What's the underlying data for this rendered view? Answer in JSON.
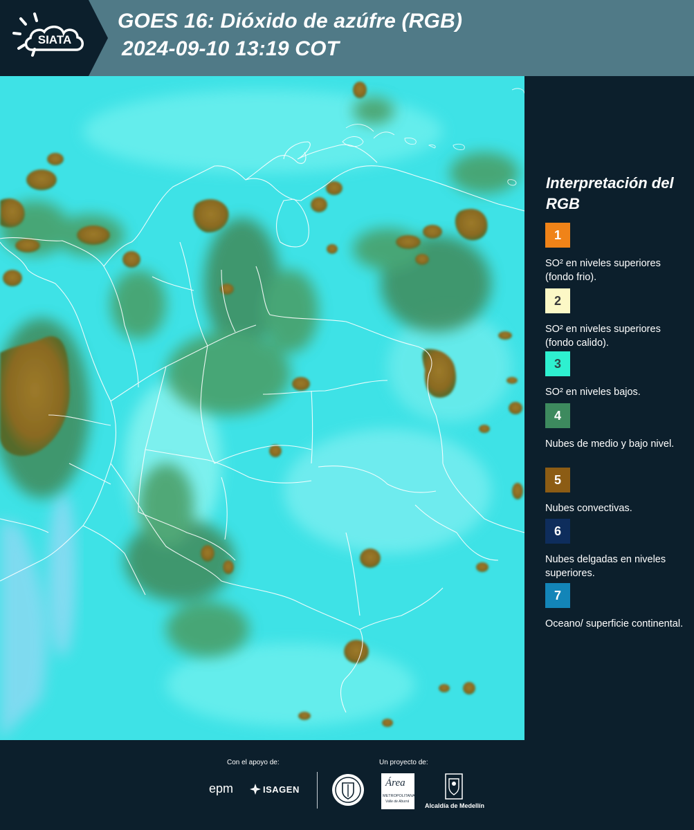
{
  "header": {
    "logo_text": "SIATA",
    "title_line1": "GOES 16: Dióxido de azúfre (RGB)",
    "title_line2": "2024-09-10 13:19 COT"
  },
  "legend": {
    "title": "Interpretación del RGB",
    "items": [
      {
        "number": "1",
        "color": "#f08318",
        "text_color": "#ffffff",
        "label": "SO² en niveles superiores (fondo frio)."
      },
      {
        "number": "2",
        "color": "#fcf8c6",
        "text_color": "#3a3a3a",
        "label": "SO² en niveles superiores (fondo calido)."
      },
      {
        "number": "3",
        "color": "#2ef0d0",
        "text_color": "#2a4a4a",
        "label": "SO² en niveles bajos."
      },
      {
        "number": "4",
        "color": "#3d8a5e",
        "text_color": "#ffffff",
        "label": "Nubes de medio y bajo nivel."
      },
      {
        "number": "5",
        "color": "#8c5c14",
        "text_color": "#ffffff",
        "label": "Nubes convectivas."
      },
      {
        "number": "6",
        "color": "#0e2d5c",
        "text_color": "#ffffff",
        "label": "Nubes delgadas en niveles superiores."
      },
      {
        "number": "7",
        "color": "#1385b8",
        "text_color": "#ffffff",
        "label": "Oceano/ superficie continental."
      }
    ]
  },
  "footer": {
    "support_caption": "Con el apoyo de:",
    "project_caption": "Un proyecto de:",
    "sponsors": [
      "epm",
      "ISAGEN"
    ],
    "partners": [
      "Área Metropolitana Valle de Aburrá",
      "Alcaldía de Medellín"
    ],
    "area_name": "Área",
    "area_sub1": "METROPOLITANA",
    "area_sub2": "Valle de Aburrá",
    "alcaldia": "Alcaldía de Medellín"
  },
  "map": {
    "background_color": "#3ee2e6",
    "cloud_colors": {
      "medium_low": "#3f8a5a",
      "convective": "#8c6a1c"
    }
  }
}
